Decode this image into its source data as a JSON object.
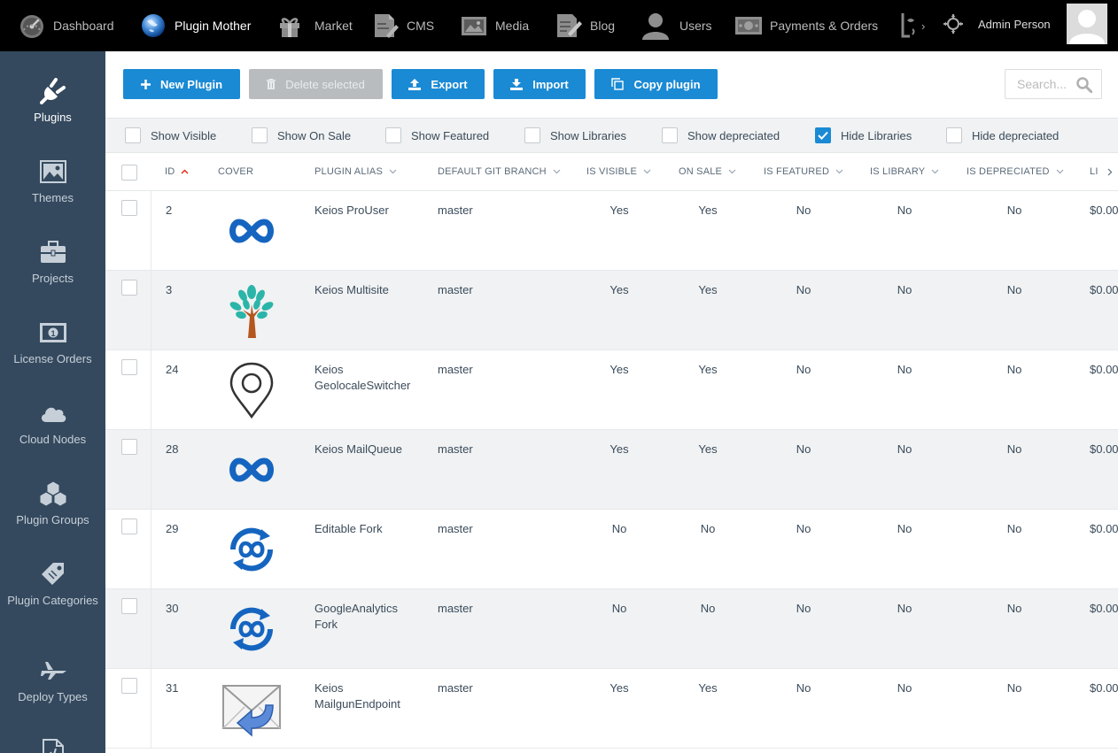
{
  "topnav": {
    "items": [
      {
        "label": "Dashboard",
        "icon": "dashboard-icon",
        "active": false
      },
      {
        "label": "Plugin Mother",
        "icon": "globe-icon",
        "active": true
      },
      {
        "label": "Market",
        "icon": "gift-icon",
        "active": false
      },
      {
        "label": "CMS",
        "icon": "cms-icon",
        "active": false
      },
      {
        "label": "Media",
        "icon": "media-icon",
        "active": false
      },
      {
        "label": "Blog",
        "icon": "blog-icon",
        "active": false
      },
      {
        "label": "Users",
        "icon": "user-icon",
        "active": false
      },
      {
        "label": "Payments & Orders",
        "icon": "money-icon",
        "active": false
      }
    ],
    "user_name": "Admin Person"
  },
  "sidebar": {
    "items": [
      {
        "label": "Plugins",
        "icon": "plug-icon",
        "active": true
      },
      {
        "label": "Themes",
        "icon": "image-icon",
        "active": false
      },
      {
        "label": "Projects",
        "icon": "briefcase-icon",
        "active": false
      },
      {
        "label": "License Orders",
        "icon": "money-icon",
        "active": false
      },
      {
        "label": "Cloud Nodes",
        "icon": "cloud-icon",
        "active": false
      },
      {
        "label": "Plugin Groups",
        "icon": "cubes-icon",
        "active": false
      },
      {
        "label": "Plugin Categories",
        "icon": "tag-icon",
        "active": false
      },
      {
        "label": "Deploy Types",
        "icon": "plane-icon",
        "active": false
      }
    ]
  },
  "toolbar": {
    "new_plugin": "New Plugin",
    "delete_selected": "Delete selected",
    "export": "Export",
    "import": "Import",
    "copy_plugin": "Copy plugin",
    "search_placeholder": "Search..."
  },
  "filters": [
    {
      "label": "Show Visible",
      "checked": false
    },
    {
      "label": "Show On Sale",
      "checked": false
    },
    {
      "label": "Show Featured",
      "checked": false
    },
    {
      "label": "Show Libraries",
      "checked": false
    },
    {
      "label": "Show depreciated",
      "checked": false
    },
    {
      "label": "Hide Libraries",
      "checked": true
    },
    {
      "label": "Hide depreciated",
      "checked": false
    }
  ],
  "table": {
    "columns": [
      "ID",
      "COVER",
      "PLUGIN ALIAS",
      "DEFAULT GIT BRANCH",
      "IS VISIBLE",
      "ON SALE",
      "IS FEATURED",
      "IS LIBRARY",
      "IS DEPRECIATED",
      "LI"
    ],
    "rows": [
      {
        "id": "2",
        "cover": "infinity-logo",
        "alias": "Keios ProUser",
        "branch": "master",
        "visible": "Yes",
        "on_sale": "Yes",
        "featured": "No",
        "library": "No",
        "depreciated": "No",
        "price": "$0.00"
      },
      {
        "id": "3",
        "cover": "tree-logo",
        "alias": "Keios Multisite",
        "branch": "master",
        "visible": "Yes",
        "on_sale": "Yes",
        "featured": "No",
        "library": "No",
        "depreciated": "No",
        "price": "$0.00"
      },
      {
        "id": "24",
        "cover": "map-pin-logo",
        "alias": "Keios GeolocaleSwitcher",
        "branch": "master",
        "visible": "Yes",
        "on_sale": "Yes",
        "featured": "No",
        "library": "No",
        "depreciated": "No",
        "price": "$0.00"
      },
      {
        "id": "28",
        "cover": "infinity-logo",
        "alias": "Keios MailQueue",
        "branch": "master",
        "visible": "Yes",
        "on_sale": "Yes",
        "featured": "No",
        "library": "No",
        "depreciated": "No",
        "price": "$0.00"
      },
      {
        "id": "29",
        "cover": "fork-logo",
        "alias": "Editable Fork",
        "branch": "master",
        "visible": "No",
        "on_sale": "No",
        "featured": "No",
        "library": "No",
        "depreciated": "No",
        "price": "$0.00"
      },
      {
        "id": "30",
        "cover": "fork-logo",
        "alias": "GoogleAnalytics Fork",
        "branch": "master",
        "visible": "No",
        "on_sale": "No",
        "featured": "No",
        "library": "No",
        "depreciated": "No",
        "price": "$0.00"
      },
      {
        "id": "31",
        "cover": "mail-logo",
        "alias": "Keios MailgunEndpoint",
        "branch": "master",
        "visible": "Yes",
        "on_sale": "Yes",
        "featured": "No",
        "library": "No",
        "depreciated": "No",
        "price": "$0.00"
      }
    ]
  },
  "colors": {
    "accent": "#1a8ad4",
    "sidebar": "#34495e",
    "topbar": "#000000",
    "sort_arrow": "#e0301e",
    "logo_blue": "#1565c0"
  }
}
